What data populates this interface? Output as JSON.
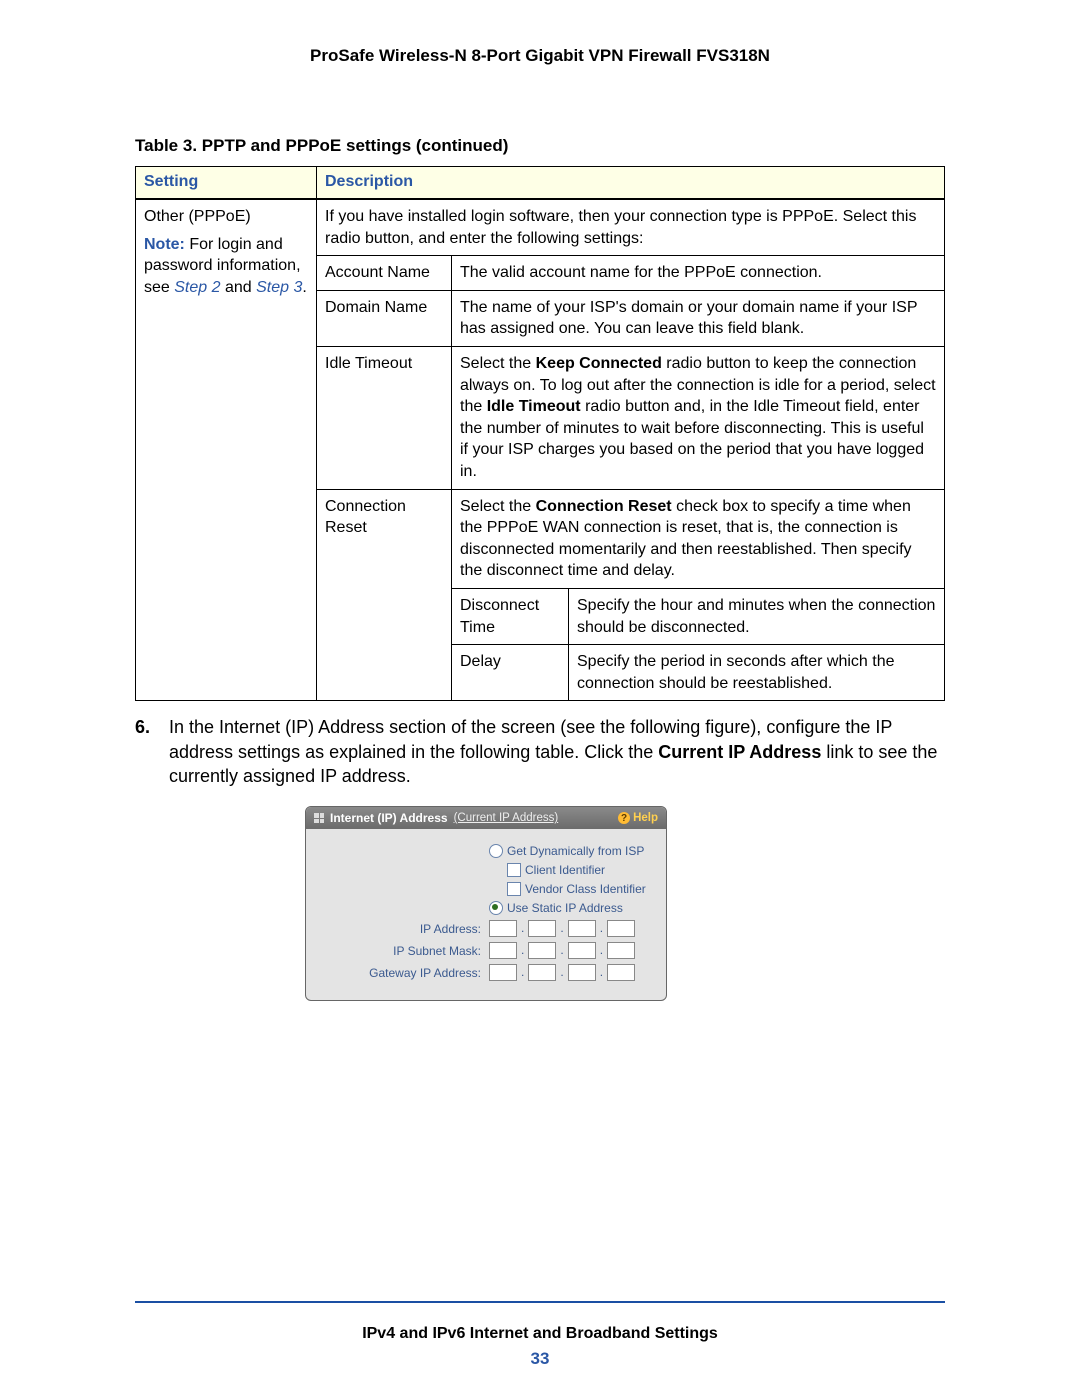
{
  "header": {
    "product_title": "ProSafe Wireless-N 8-Port Gigabit VPN Firewall FVS318N"
  },
  "table": {
    "caption": "Table 3.  PPTP and PPPoE settings (continued)",
    "columns": {
      "setting": "Setting",
      "description": "Description"
    },
    "setting_cell": {
      "name": "Other (PPPoE)",
      "note_label": "Note:",
      "note_rest": "  For login and password information, see ",
      "step2": "Step 2",
      "and": " and ",
      "step3": "Step 3",
      "period": "."
    },
    "desc_intro": "If you have installed login software, then your connection type is PPPoE. Select this radio button, and enter the following settings:",
    "rows": {
      "account_name": {
        "label": "Account Name",
        "desc": "The valid account name for the PPPoE connection."
      },
      "domain_name": {
        "label": "Domain Name",
        "desc": "The name of your ISP's domain or your domain name if your ISP has assigned one. You can leave this field blank."
      },
      "idle_timeout": {
        "label": "Idle Timeout",
        "desc_pre": "Select the ",
        "keep_connected": "Keep Connected",
        "desc_mid1": " radio button to keep the connection always on. To log out after the connection is idle for a period, select the ",
        "idle_timeout_bold": "Idle Timeout",
        "desc_post": " radio button and, in the Idle Timeout field, enter the number of minutes to wait before disconnecting. This is useful if your ISP charges you based on the period that you have logged in."
      },
      "conn_reset": {
        "label": "Connection Reset",
        "desc_pre": "Select the ",
        "conn_reset_bold": "Connection Reset",
        "desc_post": " check box to specify a time when the PPPoE WAN connection is reset, that is, the connection is disconnected momentarily and then reestablished. Then specify the disconnect time and delay.",
        "sub": {
          "disconnect_time": {
            "label": "Disconnect Time",
            "desc": "Specify the hour and minutes when the connection should be disconnected."
          },
          "delay": {
            "label": "Delay",
            "desc": "Specify the period in seconds after which the connection should be reestablished."
          }
        }
      }
    }
  },
  "step6": {
    "marker": "6.",
    "text_pre": "In the Internet (IP) Address section of the screen (see the following figure), configure the IP address settings as explained in the following table. Click the ",
    "link_bold": "Current IP Address",
    "text_post": " link to see the currently assigned IP address."
  },
  "panel": {
    "title": "Internet (IP) Address",
    "current_link": "(Current IP Address)",
    "help": "Help",
    "opts": {
      "dynamic": "Get Dynamically from ISP",
      "client_id": "Client Identifier",
      "vendor_id": "Vendor Class Identifier",
      "static": "Use Static IP Address"
    },
    "labels": {
      "ip": "IP Address:",
      "mask": "IP Subnet Mask:",
      "gateway": "Gateway IP Address:"
    }
  },
  "footer": {
    "section": "IPv4 and IPv6 Internet and Broadband Settings",
    "page": "33"
  }
}
